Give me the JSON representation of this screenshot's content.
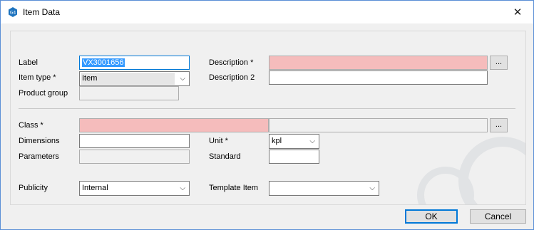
{
  "window": {
    "title": "Item Data",
    "app_icon": "g4-app-icon",
    "close_glyph": "✕"
  },
  "form": {
    "label": {
      "label": "Label",
      "value": "VX3001656"
    },
    "item_type": {
      "label": "Item type *",
      "value": "Item"
    },
    "product_group": {
      "label": "Product group",
      "value": ""
    },
    "description": {
      "label": "Description *",
      "value": "",
      "button": "..."
    },
    "description2": {
      "label": "Description 2",
      "value": ""
    },
    "class": {
      "label": "Class *",
      "value": "",
      "value2": "",
      "button": "..."
    },
    "dimensions": {
      "label": "Dimensions",
      "value": ""
    },
    "unit": {
      "label": "Unit *",
      "value": "kpl"
    },
    "parameters": {
      "label": "Parameters",
      "value": ""
    },
    "standard": {
      "label": "Standard",
      "value": ""
    },
    "publicity": {
      "label": "Publicity",
      "value": "Internal"
    },
    "template_item": {
      "label": "Template Item",
      "value": ""
    }
  },
  "buttons": {
    "ok": "OK",
    "cancel": "Cancel"
  },
  "colors": {
    "required_field": "#f5bcbc",
    "focus_border": "#0078d7",
    "selection": "#3399ff"
  }
}
